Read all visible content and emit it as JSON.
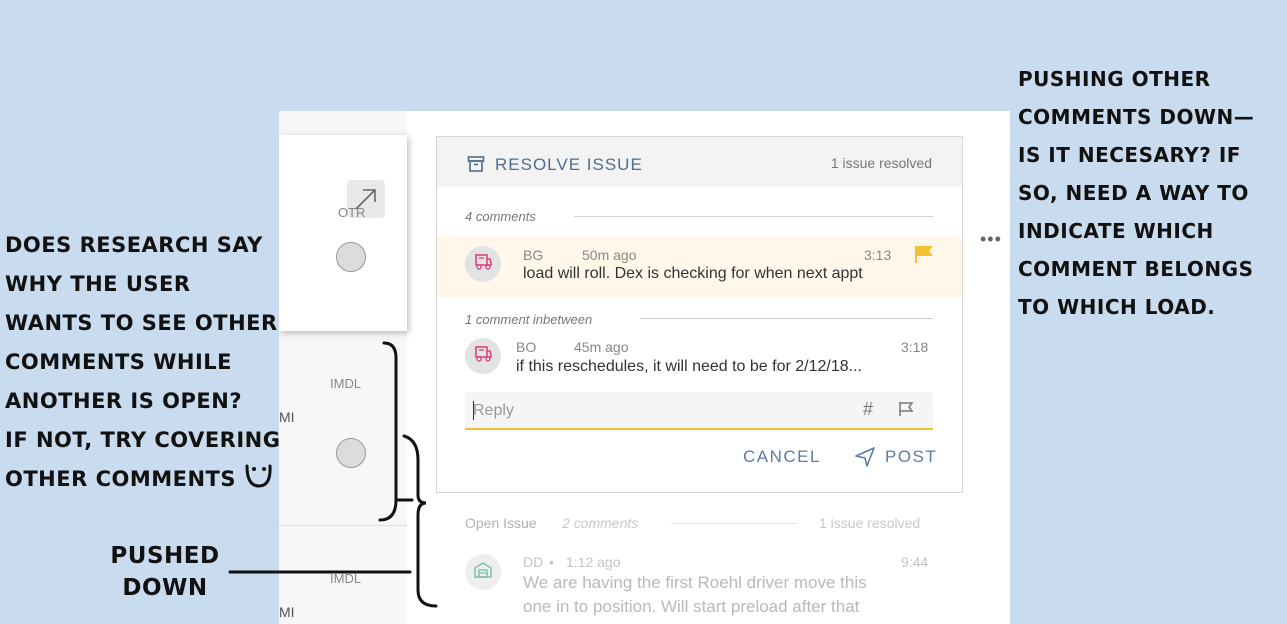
{
  "annotations": {
    "left_note": "DOES RESEARCH SAY\nWHY THE USER\nWANTS TO SEE OTHER\nCOMMENTS WHILE\nANOTHER IS OPEN?\nIF NOT, TRY COVERING\nOTHER COMMENTS",
    "pushed_down": "PUSHED\nDOWN",
    "right_note": "PUSHING OTHER\nCOMMENTS DOWN—\nIS IT NECESARY? IF\nSO, NEED A WAY TO\nINDICATE WHICH\nCOMMENT BELONGS\nTO WHICH LOAD."
  },
  "loads": [
    {
      "type": "OTR"
    },
    {
      "type": "IMDL",
      "suffix": "MI"
    },
    {
      "type": "IMDL",
      "suffix": "MI"
    }
  ],
  "resolve": {
    "title": "RESOLVE ISSUE",
    "resolved_count": "1 issue resolved",
    "comments_count": "4 comments",
    "highlight_comment": {
      "initials": "BG",
      "age": "50m ago",
      "time": "3:13",
      "text": "load will roll.  Dex is checking for when next appt"
    },
    "between_label": "1 comment inbetween",
    "second_comment": {
      "initials": "BO",
      "age": "45m ago",
      "time": "3:18",
      "text": "if this reschedules, it will need to be for 2/12/18..."
    },
    "reply_placeholder": "Reply",
    "hash_glyph": "#",
    "cancel_label": "CANCEL",
    "post_label": "POST"
  },
  "open_issue": {
    "label": "Open Issue",
    "comments_count": "2 comments",
    "resolved_count": "1 issue resolved",
    "comment": {
      "initials": "DD",
      "age": "1:12 ago",
      "time": "9:44",
      "line1": "We are having the first Roehl driver move this",
      "line2": "one in to position.  Will start preload after that"
    }
  },
  "colors": {
    "background": "#c9dbee",
    "accent_blue": "#5b7ca3",
    "flag_yellow": "#f2c033",
    "avatar_icon_pink": "#d9447f",
    "avatar_icon_green": "#7fc0a6"
  }
}
